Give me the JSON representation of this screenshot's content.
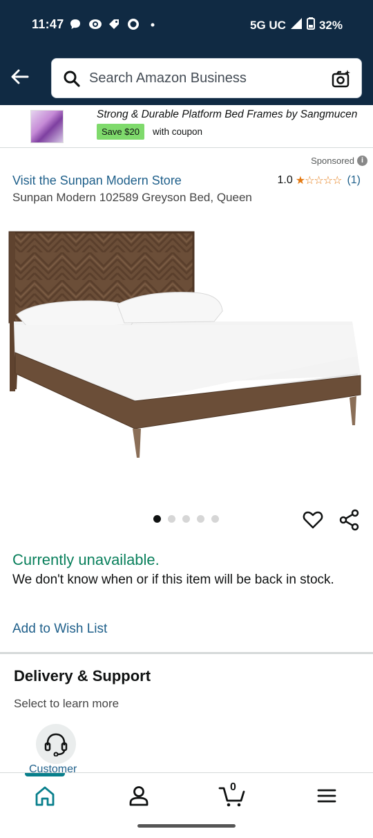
{
  "status_bar": {
    "time": "11:47",
    "network": "5G UC",
    "battery": "32%"
  },
  "search": {
    "placeholder": "Search Amazon Business"
  },
  "ad": {
    "title": "Strong & Durable Platform Bed Frames by Sangmucen",
    "save_badge": "Save $20",
    "coupon_text": "with coupon"
  },
  "sponsored_label": "Sponsored",
  "product": {
    "store_link": "Visit the Sunpan Modern Store",
    "rating_value": "1.0",
    "rating_stars": 1,
    "rating_stars_text": "★☆☆☆☆",
    "rating_count": "(1)",
    "title": "Sunpan Modern 102589 Greyson Bed, Queen",
    "image_count": 5,
    "active_image": 1
  },
  "availability": {
    "status": "Currently unavailable.",
    "description": "We don't know when or if this item will be back in stock.",
    "wishlist_link": "Add to Wish List"
  },
  "delivery": {
    "title": "Delivery & Support",
    "subtitle": "Select to learn more",
    "customer_service_label": "Customer"
  },
  "bottom_nav": {
    "cart_count": "0",
    "items": [
      "home-icon",
      "account-icon",
      "cart-icon",
      "menu-icon"
    ]
  },
  "colors": {
    "header": "#102a43",
    "link": "#1e5f8a",
    "unavailable": "#087f5b",
    "star": "#e47911",
    "save_badge": "#7fda6c",
    "nav_indicator": "#087f8c"
  }
}
